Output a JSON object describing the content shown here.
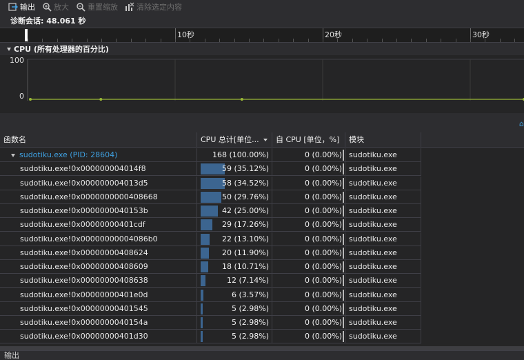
{
  "toolbar": {
    "output": "输出",
    "zoom_in": "放大",
    "reset_zoom": "重置缩放",
    "clear_selection": "清除选定内容"
  },
  "session": {
    "label": "诊断会话: 48.061 秒"
  },
  "ruler": {
    "labels": [
      "10秒",
      "20秒",
      "30秒"
    ]
  },
  "cpu_section": {
    "title": "CPU (所有处理器的百分比)"
  },
  "chart_data": {
    "type": "line",
    "title": "CPU (所有处理器的百分比)",
    "ylim": [
      0,
      100
    ],
    "yticks": [
      "100",
      "0"
    ],
    "series": [
      {
        "values": [
          0,
          0,
          0,
          0,
          0,
          0,
          0,
          0
        ]
      }
    ],
    "color": "#9ab836"
  },
  "table": {
    "columns": [
      "函数名",
      "CPU 总计[单位...",
      "自 CPU [单位，%]",
      "模块"
    ],
    "rows": [
      {
        "name": "sudotiku.exe (PID: 28604)",
        "total": "168 (100.00%)",
        "pct": 100.0,
        "self": "0 (0.00%)",
        "module": "sudotiku.exe",
        "parent": true
      },
      {
        "name": "sudotiku.exe!0x000000004014f8",
        "total": "59 (35.12%)",
        "pct": 35.12,
        "self": "0 (0.00%)",
        "module": "sudotiku.exe"
      },
      {
        "name": "sudotiku.exe!0x000000004013d5",
        "total": "58 (34.52%)",
        "pct": 34.52,
        "self": "0 (0.00%)",
        "module": "sudotiku.exe"
      },
      {
        "name": "sudotiku.exe!0x0000000000408668",
        "total": "50 (29.76%)",
        "pct": 29.76,
        "self": "0 (0.00%)",
        "module": "sudotiku.exe"
      },
      {
        "name": "sudotiku.exe!0x0000000040153b",
        "total": "42 (25.00%)",
        "pct": 25.0,
        "self": "0 (0.00%)",
        "module": "sudotiku.exe"
      },
      {
        "name": "sudotiku.exe!0x00000000401cdf",
        "total": "29 (17.26%)",
        "pct": 17.26,
        "self": "0 (0.00%)",
        "module": "sudotiku.exe"
      },
      {
        "name": "sudotiku.exe!0x00000000004086b0",
        "total": "22 (13.10%)",
        "pct": 13.1,
        "self": "0 (0.00%)",
        "module": "sudotiku.exe"
      },
      {
        "name": "sudotiku.exe!0x00000000408624",
        "total": "20 (11.90%)",
        "pct": 11.9,
        "self": "0 (0.00%)",
        "module": "sudotiku.exe"
      },
      {
        "name": "sudotiku.exe!0x00000000408609",
        "total": "18 (10.71%)",
        "pct": 10.71,
        "self": "0 (0.00%)",
        "module": "sudotiku.exe"
      },
      {
        "name": "sudotiku.exe!0x00000000408638",
        "total": "12 (7.14%)",
        "pct": 7.14,
        "self": "0 (0.00%)",
        "module": "sudotiku.exe"
      },
      {
        "name": "sudotiku.exe!0x00000000401e0d",
        "total": "6 (3.57%)",
        "pct": 3.57,
        "self": "0 (0.00%)",
        "module": "sudotiku.exe"
      },
      {
        "name": "sudotiku.exe!0x00000000401545",
        "total": "5 (2.98%)",
        "pct": 2.98,
        "self": "0 (0.00%)",
        "module": "sudotiku.exe"
      },
      {
        "name": "sudotiku.exe!0x0000000040154a",
        "total": "5 (2.98%)",
        "pct": 2.98,
        "self": "0 (0.00%)",
        "module": "sudotiku.exe"
      },
      {
        "name": "sudotiku.exe!0x00000000401d30",
        "total": "5 (2.98%)",
        "pct": 2.98,
        "self": "0 (0.00%)",
        "module": "sudotiku.exe"
      }
    ]
  },
  "bottom": {
    "label": "输出"
  },
  "colors": {
    "bar": "#3c6590",
    "link": "#3fa0e0",
    "cpu_line": "#9ab836"
  }
}
